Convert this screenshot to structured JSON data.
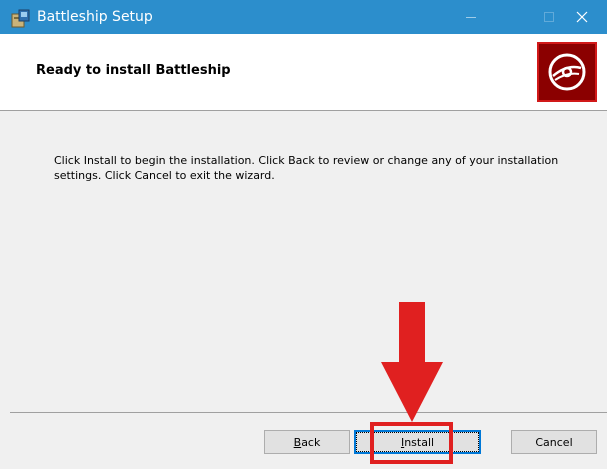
{
  "window": {
    "title": "Battleship Setup",
    "controls": [
      "minimize",
      "maximize",
      "close"
    ],
    "title_bar_color": "#2c8ecc"
  },
  "banner": {
    "title": "Ready to install Battleship",
    "logo_icon": "disc-icon"
  },
  "content": {
    "message": "Click Install to begin the installation. Click Back to review or change any of your installation settings. Click Cancel to exit the wizard."
  },
  "buttons": {
    "back": {
      "label": "Back",
      "accel": "B"
    },
    "install": {
      "label": "Install",
      "accel": "I"
    },
    "cancel": {
      "label": "Cancel"
    }
  },
  "annotation": {
    "color": "#e02020",
    "target": "install-button"
  }
}
